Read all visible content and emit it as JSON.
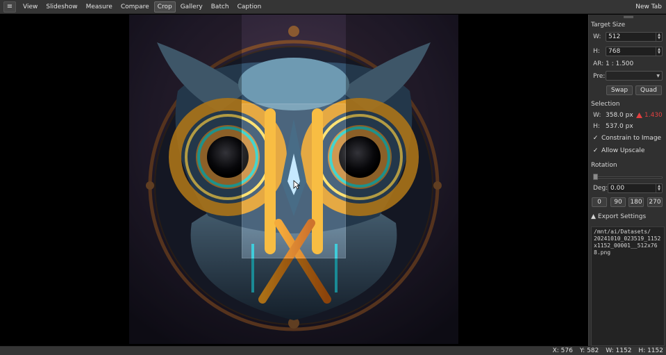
{
  "menubar": {
    "items": [
      "View",
      "Slideshow",
      "Measure",
      "Compare",
      "Crop",
      "Gallery",
      "Batch",
      "Caption"
    ],
    "active": "Crop",
    "new_tab": "New Tab"
  },
  "panel": {
    "target_size": {
      "title": "Target Size",
      "w_label": "W:",
      "w_value": "512",
      "h_label": "H:",
      "h_value": "768",
      "ar_label": "AR:",
      "ar_value": "1 : 1.500",
      "pre_label": "Pre:",
      "pre_value": "",
      "swap": "Swap",
      "quad": "Quad"
    },
    "selection": {
      "title": "Selection",
      "w_label": "W:",
      "w_value": "358.0 px",
      "warn_value": "1.430",
      "h_label": "H:",
      "h_value": "537.0 px",
      "constrain": "Constrain to Image",
      "upscale": "Allow Upscale"
    },
    "rotation": {
      "title": "Rotation",
      "slider_fraction": 0.0,
      "deg_label": "Deg:",
      "deg_value": "0.00",
      "presets": [
        "0",
        "90",
        "180",
        "270"
      ]
    },
    "export": {
      "title": "Export Settings",
      "toggle": "▲",
      "path": "/mnt/ai/Datasets/\n20241010_023519_1152x1152_00001__512x768.png"
    }
  },
  "statusbar": {
    "x": "X: 576",
    "y": "Y: 582",
    "w": "W: 1152",
    "h": "H: 1152"
  },
  "icons": {
    "hamburger": "hamburger-icon",
    "warning": "warning-icon",
    "cursor": "mouse-cursor-icon",
    "checkmark": "checkmark-icon"
  },
  "colors": {
    "warning": "#e34040",
    "panel_bg": "#303030",
    "menubar_bg": "#353535"
  }
}
